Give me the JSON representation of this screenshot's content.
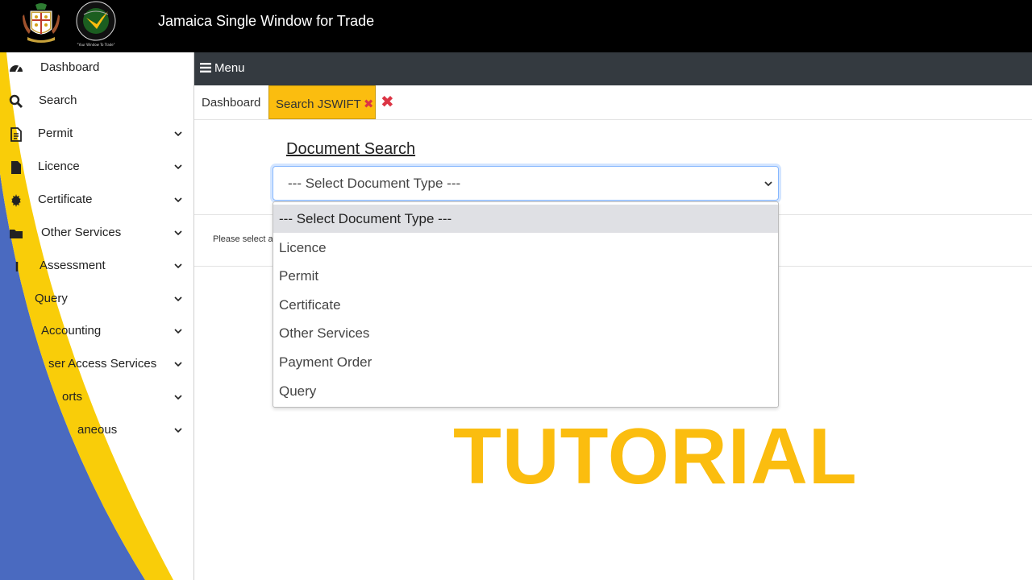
{
  "app": {
    "title": "Jamaica Single Window for Trade",
    "logo_text": "JAMAICA SINGLE WINDOW FOR TRADE",
    "logo_tagline": "Your Window To Trade"
  },
  "sidebar": {
    "items": [
      {
        "label": "Dashboard",
        "icon": "dashboard-icon"
      },
      {
        "label": "Search",
        "icon": "search-icon"
      },
      {
        "label": "Permit",
        "icon": "document-icon"
      },
      {
        "label": "Licence",
        "icon": "file-icon"
      },
      {
        "label": "Certificate",
        "icon": "certificate-icon"
      },
      {
        "label": "Other Services",
        "icon": "folder-icon"
      },
      {
        "label": "Assessment",
        "icon": "assessment-icon"
      },
      {
        "label": "Query",
        "icon": ""
      },
      {
        "label": "Accounting",
        "icon": ""
      },
      {
        "label": "ser Access Services",
        "icon": ""
      },
      {
        "label": "orts",
        "icon": ""
      },
      {
        "label": "aneous",
        "icon": ""
      }
    ]
  },
  "menubar": {
    "label": "Menu"
  },
  "tabs": {
    "dashboard": "Dashboard",
    "active": "Search JSWIFT",
    "close_symbol": "✖"
  },
  "main": {
    "title": "Document Search",
    "hint": "Please select a",
    "select": {
      "value": "--- Select Document Type ---",
      "options": [
        "--- Select Document Type ---",
        "Licence",
        "Permit",
        "Certificate",
        "Other Services",
        "Payment Order",
        "Query"
      ]
    }
  },
  "overlay": {
    "text": "TUTORIAL"
  },
  "colors": {
    "accent_yellow": "#fbbd0f",
    "deco_blue": "#4a6ac0",
    "menubar": "#343a40",
    "close_red": "#dc3545"
  }
}
